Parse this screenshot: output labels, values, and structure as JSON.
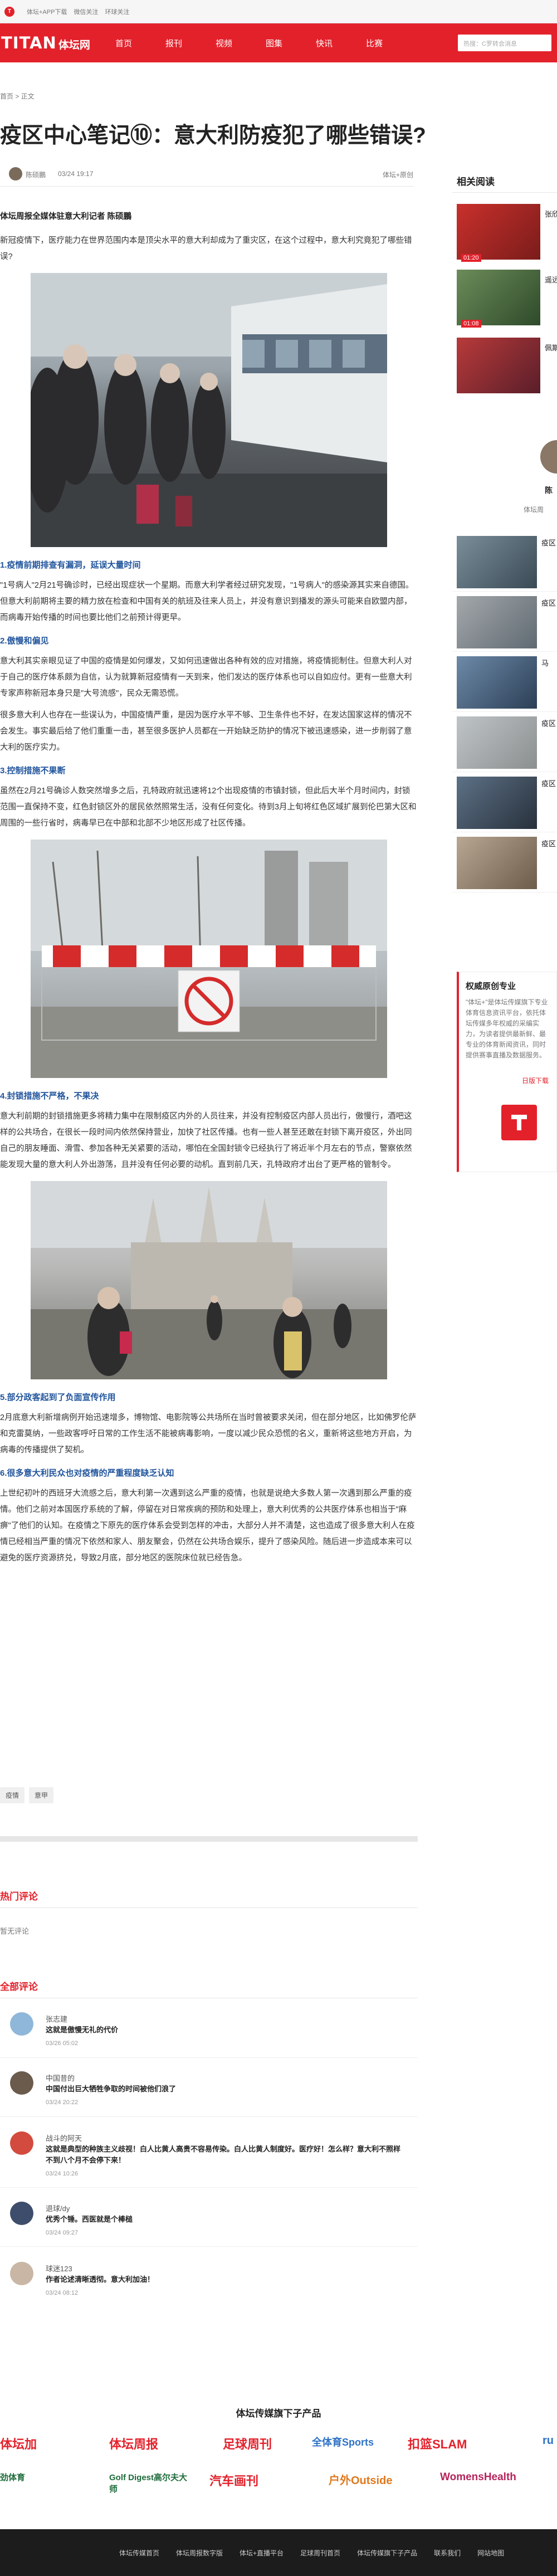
{
  "topbar": {
    "items": [
      "体坛+APP下载",
      "微信关注",
      "环球关注"
    ]
  },
  "nav": {
    "logo_text": "TITAN",
    "logo_cn": "体坛网",
    "items": [
      "首页",
      "报刊",
      "视频",
      "图集",
      "快讯",
      "比赛"
    ],
    "search_placeholder": "热搜：C罗转会消息"
  },
  "breadcrumb": "首页 > 正文",
  "article": {
    "title": "疫区中心笔记⑩：意大利防疫犯了哪些错误?",
    "author": "陈硕鵬",
    "date": "03/24 19:17",
    "source": "体坛+原创",
    "byline": "体坛周报全媒体驻意大利记者 陈硕鵬",
    "intro": "新冠疫情下，医疗能力在世界范围内本是顶尖水平的意大利却成为了重灾区，在这个过程中，意大利究竟犯了哪些错误?",
    "s1_title": "1.疫情前期排查有漏洞，延误大量时间",
    "s1_text": "\"1号病人\"2月21号确诊时，已经出现症状一个星期。而意大利学者经过研究发现，\"1号病人\"的感染源其实来自德国。但意大利前期将主要的精力放在检查和中国有关的航班及往来人员上，并没有意识到播发的源头可能来自欧盟内部，而病毒开始传播的时间也要比他们之前预计得更早。",
    "s2_title": "2.傲慢和偏见",
    "s2_text": "意大利其实亲眼见证了中国的疫情是如何爆发，又如何迅速做出各种有效的应对措施，将疫情扼制住。但意大利人对于自己的医疗体系颇为自信，认为就算新冠疫情有一天到来，他们发达的医疗体系也可以自如应付。更有一些意大利专家声称新冠本身只是\"大号流感\"，民众无需恐慌。",
    "s2_text2": "很多意大利人也存在一些误认为，中国疫情严重，是因为医疗水平不够、卫生条件也不好，在发达国家这样的情况不会发生。事实最后给了他们重重一击，甚至很多医护人员都在一开始缺乏防护的情况下被迅速感染，进一步削弱了意大利的医疗实力。",
    "s3_title": "3.控制措施不果断",
    "s3_text": "虽然在2月21号确诊人数突然增多之后，孔特政府就迅速将12个出现疫情的市镇封锁，但此后大半个月时间内，封锁范围一直保持不变，红色封锁区外的居民依然照常生活，没有任何变化。待到3月上旬将红色区域扩展到伦巴第大区和周围的一些行省时，病毒早已在中部和北部不少地区形成了社区传播。",
    "s4_title": "4.封锁措施不严格，不果决",
    "s4_text": "意大利前期的封锁措施更多将精力集中在限制疫区内外的人员往来，并没有控制疫区内部人员出行，傲慢行，酒吧这样的公共场合，在很长一段时间内依然保持营业，加快了社区传播。也有一些人甚至还敢在封锁下离开疫区，外出同自己的朋友睡面、滑雪、参加各种无关紧要的活动，哪怕在全国封锁令已经执行了将近半个月左右的节点，警察依然能发现大量的意大利人外出游荡，且并没有任何必要的动机。直到前几天，孔特政府才出台了更严格的管制令。",
    "s5_title": "5.部分政客起到了负面宣传作用",
    "s5_text": "2月底意大利新增病例开始迅速增多，博物馆、电影院等公共场所在当时曾被要求关闭，但在部分地区，比如佛罗伦萨和克雷莫纳，一些政客呼吁日常的工作生活不能被病毒影响，一度以减少民众恐慌的名义，重新将这些地方开启，为病毒的传播提供了契机。",
    "s6_title": "6.很多意大利民众也对疫情的严重程度缺乏认知",
    "s6_text": "上世纪初叶的西班牙大流感之后，意大利第一次遇到这么严重的疫情，也就是说绝大多数人第一次遇到那么严重的疫情。他们之前对本国医疗系统的了解，停留在对日常疾病的预防和处理上，意大利优秀的公共医疗体系也相当于\"麻痹\"了他们的认知。在疫情之下原先的医疗体系会受到怎样的冲击，大部分人并不清楚，这也造成了很多意大利人在疫情已经相当严重的情况下依然和家人、朋友聚会，仍然在公共场合娱乐，提升了感染风险。随后进一步造成本来可以避免的医疗资源挤兑，导致2月底，部分地区的医院床位就已经告急。",
    "tags": [
      "疫情",
      "意甲"
    ]
  },
  "sidebar": {
    "related_title": "相关阅读",
    "videos": [
      {
        "text": "张欣",
        "dur": "01:20"
      },
      {
        "text": "遥远",
        "dur": "01:08"
      },
      {
        "text": "佩斯",
        "dur": ""
      }
    ],
    "profile_name": "陈",
    "profile_sub": "体坛周",
    "related": [
      "疫区",
      "疫区",
      "马",
      "疫区",
      "疫区",
      "疫区"
    ],
    "promo_title": "权威原创专业",
    "promo_desc": "\"体坛+\"是体坛传媒旗下专业体育信息资讯平台，依托体坛传媒多年权威的采编实力，为读者提供最新鲜、最专业的体育新闻资讯，同时提供赛事直播及数据服务。",
    "promo_link": "日版下载"
  },
  "comments": {
    "hot_title": "热门评论",
    "none": "暂无评论",
    "all_title": "全部评论",
    "list": [
      {
        "name": "张志建",
        "text": "这就是傲慢无礼的代价",
        "time": "03/26 05:02"
      },
      {
        "name": "中国昔的",
        "text": "中国付出巨大牺牲争取的时间被他们浪了",
        "time": "03/24 20:22"
      },
      {
        "name": "战斗的阿天",
        "text": "这就是典型的种族主义歧视！白人比黄人高贵不容易传染。白人比黄人制度好。医疗好！怎么样？意大利不照样不到八个月不会停下来！",
        "time": "03/24 10:26"
      },
      {
        "name": "退球/dy",
        "text": "优秀个锤。西医就是个棒槌",
        "time": "03/24 09:27"
      },
      {
        "name": "球迷123",
        "text": "作者论述清晰透彻。意大利加油！",
        "time": "03/24 08:12"
      }
    ]
  },
  "footer": {
    "brands_title": "体坛传媒旗下子产品",
    "brands_row1": [
      "体坛加",
      "体坛周报",
      "足球周刊",
      "全体育Sports",
      "扣篮SLAM",
      "ru"
    ],
    "brands_row2": [
      "劲体育",
      "Golf Digest高尔夫大师",
      "汽车画刊",
      "户外Outside",
      "WomensHealth",
      ""
    ],
    "links": [
      "体坛传媒首页",
      "体坛周报数字版",
      "体坛+直播平台",
      "足球周刊首页",
      "体坛传媒旗下子产品",
      "联系我们",
      "网站地图"
    ]
  }
}
